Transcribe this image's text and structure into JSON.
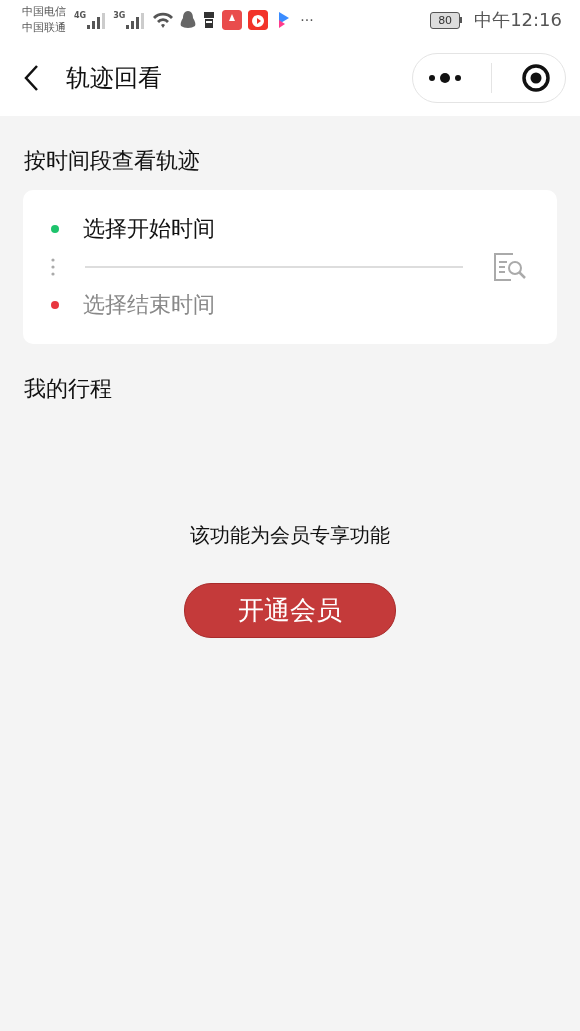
{
  "status_bar": {
    "carriers": [
      "中国电信",
      "中国联通"
    ],
    "signals": [
      {
        "label": "4G"
      },
      {
        "label": "3G"
      }
    ],
    "more": "···",
    "battery": "80",
    "time": "中午12:16"
  },
  "nav": {
    "title": "轨迹回看"
  },
  "time_range": {
    "heading": "按时间段查看轨迹",
    "items": [
      {
        "label": "选择开始时间",
        "color": "#1dc36c",
        "dimmed": false
      },
      {
        "label": "选择结束时间",
        "color": "#e8373f",
        "dimmed": true
      }
    ]
  },
  "trips": {
    "heading": "我的行程",
    "notice": "该功能为会员专享功能",
    "button": "开通会员"
  }
}
